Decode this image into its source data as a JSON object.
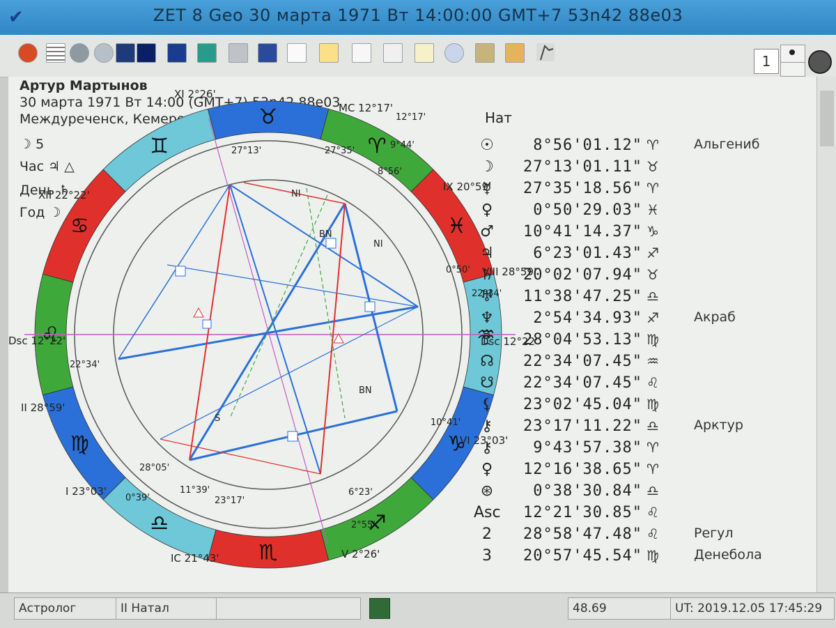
{
  "window": {
    "title": "ZET 8 Geo   30 марта 1971  Вт   14:00:00 GMT+7 53n42  88e03"
  },
  "toolbar": {
    "zoom_value": "1"
  },
  "header": {
    "name": "Артур Мартынов",
    "line2": "30 марта 1971  Вт   14:00 (GMT+7) 53n42  88e03",
    "line3": "Междуреченск, Кемеровская обл., Россия",
    "line4": "☽  5",
    "line5": "Час  ♃  △",
    "line6": "День  ♄",
    "line7": "Год  ☽"
  },
  "chart": {
    "nat_label": "Нат",
    "houses": [
      "XI 2°26'",
      "MC 12°17'",
      "IX 20°59'",
      "VIII 28°59'",
      "Dsc 12°22'",
      "VI 23°03'",
      "V 2°26'",
      "IC 21°43'",
      "II 28°59'",
      "Dsc 12°22'",
      "XII 22°22'",
      "I 23°03'"
    ],
    "planet_labels": [
      "27°13'",
      "27°35'",
      "8°56'",
      "9°44'",
      "0°50'",
      "22°34'",
      "10°41'",
      "6°23'",
      "2°55'",
      "23°17'",
      "11°39'",
      "0°39'",
      "28°05'",
      "22°34'",
      "12°17'"
    ],
    "inner_labels": [
      "NI",
      "BN",
      "NI",
      "BN",
      "S"
    ],
    "colors": {
      "red": "#e0302c",
      "green": "#3fa83a",
      "blue": "#2a70d8",
      "cyan": "#6ec8d8"
    }
  },
  "positions": [
    {
      "glyph": "☉",
      "deg": "8°56'01.12\"",
      "sign": "♈",
      "star": "Альгениб"
    },
    {
      "glyph": "☽",
      "deg": "27°13'01.11\"",
      "sign": "♉",
      "star": ""
    },
    {
      "glyph": "☿",
      "deg": "27°35'18.56\"",
      "sign": "♈",
      "star": ""
    },
    {
      "glyph": "♀",
      "deg": "0°50'29.03\"",
      "sign": "♓",
      "star": ""
    },
    {
      "glyph": "♂",
      "deg": "10°41'14.37\"",
      "sign": "♑",
      "star": ""
    },
    {
      "glyph": "♃",
      "deg": "6°23'01.43\"",
      "sign": "♐",
      "star": ""
    },
    {
      "glyph": "♄",
      "deg": "20°02'07.94\"",
      "sign": "♉",
      "star": ""
    },
    {
      "glyph": "♅",
      "deg": "11°38'47.25\"",
      "sign": "♎",
      "star": ""
    },
    {
      "glyph": "♆",
      "deg": "2°54'34.93\"",
      "sign": "♐",
      "star": "Акраб"
    },
    {
      "glyph": "♇",
      "deg": "28°04'53.13\"",
      "sign": "♍",
      "star": ""
    },
    {
      "glyph": "☊",
      "deg": "22°34'07.45\"",
      "sign": "♒",
      "star": ""
    },
    {
      "glyph": "☋",
      "deg": "22°34'07.45\"",
      "sign": "♌",
      "star": ""
    },
    {
      "glyph": "⚸",
      "deg": "23°02'45.04\"",
      "sign": "♍",
      "star": ""
    },
    {
      "glyph": "⚷",
      "deg": "23°17'11.22\"",
      "sign": "♎",
      "star": "Арктур"
    },
    {
      "glyph": "⚷",
      "deg": "9°43'57.38\"",
      "sign": "♈",
      "star": ""
    },
    {
      "glyph": "♀",
      "deg": "12°16'38.65\"",
      "sign": "♈",
      "star": ""
    },
    {
      "glyph": "⊛",
      "deg": "0°38'30.84\"",
      "sign": "♎",
      "star": ""
    },
    {
      "glyph": "Asc",
      "deg": "12°21'30.85\"",
      "sign": "♌",
      "star": ""
    },
    {
      "glyph": "2",
      "deg": "28°58'47.48\"",
      "sign": "♌",
      "star": "Регул"
    },
    {
      "glyph": "3",
      "deg": "20°57'45.54\"",
      "sign": "♍",
      "star": "Денебола"
    }
  ],
  "status": {
    "left": "Астролог",
    "mode": "II Натал",
    "value": "48.69",
    "ut": "UT: 2019.12.05 17:45:29"
  }
}
